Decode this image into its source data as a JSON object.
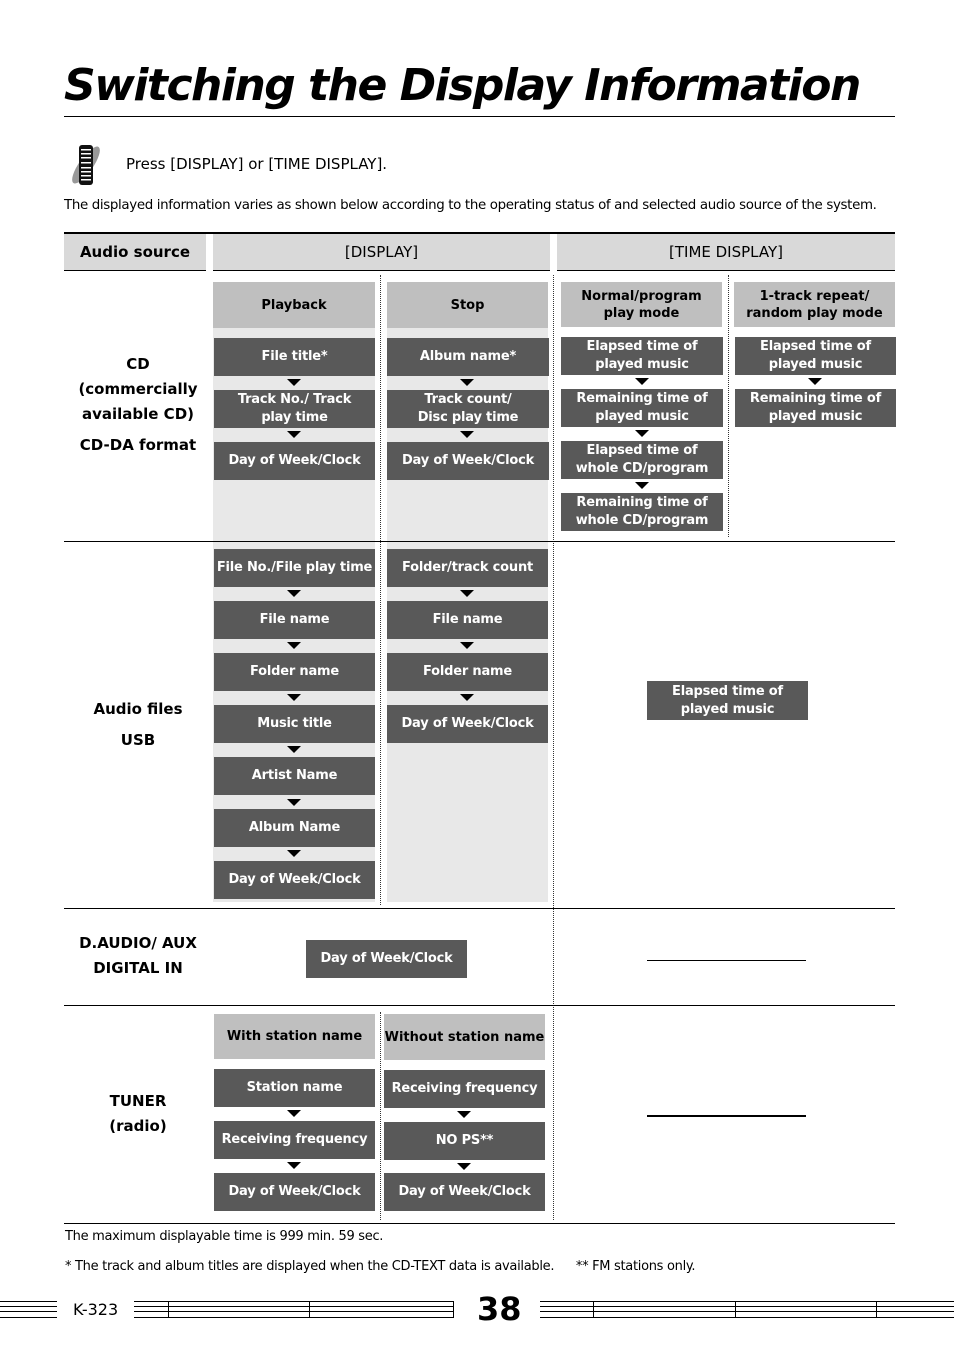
{
  "page": {
    "title": "Switching the Display Information",
    "instruction": "Press [DISPLAY] or [TIME DISPLAY].",
    "instruction_icon": "remote-control-icon",
    "description": "The displayed information varies as shown below according to the operating status of and selected audio source of the system."
  },
  "table": {
    "headers": {
      "source": "Audio source",
      "display": "[DISPLAY]",
      "time_display": "[TIME DISPLAY]"
    },
    "cd": {
      "source": [
        "CD",
        "(commercially",
        "available CD)",
        "CD-DA format"
      ],
      "playback_label": "Playback",
      "stop_label": "Stop",
      "normal_label": "Normal/program play mode",
      "repeat_label": "1-track repeat/ random play mode",
      "playback": [
        "File title*",
        "Track No./ Track play time",
        "Day of Week/Clock"
      ],
      "stop": [
        "Album name*",
        "Track count/ Disc play time",
        "Day of Week/Clock"
      ],
      "normal": [
        "Elapsed time of played music",
        "Remaining time of played music",
        "Elapsed time of whole CD/program",
        "Remaining time of whole CD/program"
      ],
      "repeat": [
        "Elapsed time of played music",
        "Remaining time of played music"
      ]
    },
    "audio_files": {
      "source": [
        "Audio files",
        "USB"
      ],
      "playback": [
        "File No./File play time",
        "File name",
        "Folder name",
        "Music title",
        "Artist Name",
        "Album Name",
        "Day of Week/Clock"
      ],
      "stop": [
        "Folder/track count",
        "File name",
        "Folder name",
        "Day of Week/Clock"
      ],
      "time": "Elapsed time of played music"
    },
    "daudio": {
      "source": [
        "D.AUDIO/ AUX",
        "DIGITAL IN"
      ],
      "display": "Day of Week/Clock"
    },
    "tuner": {
      "source": [
        "TUNER",
        "(radio)"
      ],
      "with_label": "With station name",
      "without_label": "Without station name",
      "with": [
        "Station name",
        "Receiving frequency",
        "Day of Week/Clock"
      ],
      "without": [
        "Receiving frequency",
        "NO PS**",
        "Day of Week/Clock"
      ]
    }
  },
  "notes": {
    "max_time": "The maximum displayable time is 999 min. 59 sec.",
    "footnote_1": "* The track and album titles are displayed when the CD-TEXT data is available.",
    "footnote_2": "** FM stations only."
  },
  "footer": {
    "model": "K-323",
    "page_number": "38"
  }
}
